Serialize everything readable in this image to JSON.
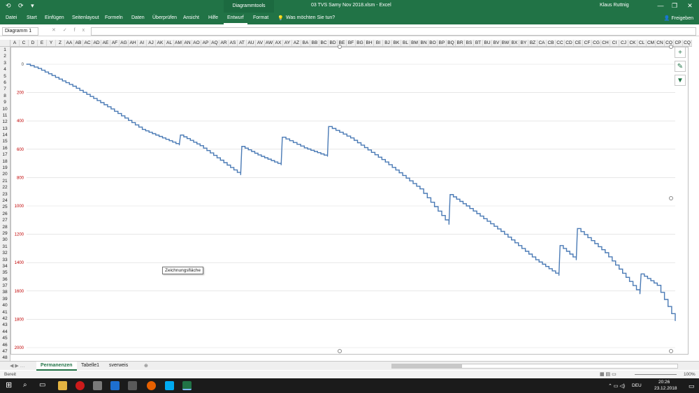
{
  "window": {
    "quick_access": "⟲ ⟳ ▾",
    "context_tab": "Diagrammtools",
    "title": "03 TVS Samy Nov 2018.xlsm  -  Excel",
    "user": "Klaus Ruttnig",
    "minimize": "—",
    "restore": "❐",
    "close": "✕"
  },
  "ribbon": {
    "tabs": [
      "Datei",
      "Start",
      "Einfügen",
      "Seitenlayout",
      "Formeln",
      "Daten",
      "Überprüfen",
      "Ansicht",
      "Hilfe",
      "Entwurf",
      "Format"
    ],
    "tell_me": "Was möchten Sie tun?",
    "share": "Freigeben"
  },
  "formula_bar": {
    "name_box": "Diagramm 1",
    "fx_label": "fx",
    "value": ""
  },
  "columns": [
    "A",
    "C",
    "D",
    "E",
    "Y",
    "Z",
    "AA",
    "AB",
    "AC",
    "AD",
    "AE",
    "AF",
    "AG",
    "AH",
    "AI",
    "AJ",
    "AK",
    "AL",
    "AM",
    "AN",
    "AO",
    "AP",
    "AQ",
    "AR",
    "AS",
    "AT",
    "AU",
    "AV",
    "AW",
    "AX",
    "AY",
    "AZ",
    "BA",
    "BB",
    "BC",
    "BD",
    "BE",
    "BF",
    "BG",
    "BH",
    "BI",
    "BJ",
    "BK",
    "BL",
    "BM",
    "BN",
    "BO",
    "BP",
    "BQ",
    "BR",
    "BS",
    "BT",
    "BU",
    "BV",
    "BW",
    "BX",
    "BY",
    "BZ",
    "CA",
    "CB",
    "CC",
    "CD",
    "CE",
    "CF",
    "CG",
    "CH",
    "CI",
    "CJ",
    "CK",
    "CL",
    "CM",
    "CN",
    "CO",
    "CP",
    "CQ"
  ],
  "rows": [
    "1",
    "2",
    "3",
    "4",
    "5",
    "6",
    "7",
    "8",
    "9",
    "10",
    "11",
    "12",
    "13",
    "14",
    "15",
    "16",
    "17",
    "18",
    "19",
    "20",
    "21",
    "22",
    "23",
    "24",
    "25",
    "26",
    "27",
    "28",
    "29",
    "30",
    "31",
    "32",
    "33",
    "34",
    "35",
    "36",
    "37",
    "38",
    "39",
    "40",
    "41",
    "42",
    "43",
    "44",
    "45",
    "46",
    "47",
    "48"
  ],
  "chart_tooltip": "Zeichnungsfläche",
  "chart_buttons": [
    "+",
    "✎",
    "▼"
  ],
  "chart_data": {
    "type": "line",
    "title": "",
    "xlabel": "",
    "ylabel": "",
    "y_axis_reversed": true,
    "ylim": [
      0,
      2000
    ],
    "yticks": [
      0,
      200,
      400,
      600,
      800,
      1000,
      1200,
      1400,
      1600,
      1800,
      2000
    ],
    "xlim": [
      0,
      56050
    ],
    "series": [
      {
        "color": "#4a7ab5",
        "x": [
          0,
          1000,
          4000,
          7000,
          10000,
          13200,
          13300,
          15000,
          18500,
          18600,
          20000,
          22000,
          22100,
          24000,
          26000,
          26100,
          28000,
          31000,
          34000,
          36500,
          36600,
          38000,
          41000,
          44000,
          46000,
          46100,
          47500,
          47600,
          50000,
          53000,
          53100,
          54500,
          56050
        ],
        "values": [
          0,
          30,
          155,
          300,
          460,
          570,
          500,
          575,
          780,
          580,
          640,
          710,
          515,
          590,
          650,
          440,
          520,
          690,
          880,
          1130,
          920,
          1000,
          1180,
          1380,
          1490,
          1280,
          1380,
          1160,
          1330,
          1620,
          1480,
          1560,
          1810
        ]
      }
    ]
  },
  "sheet_tabs": {
    "items": [
      "Permanenzen",
      "Tabelle1",
      "sverweis"
    ],
    "add": "⊕"
  },
  "status": {
    "ready": "Bereit",
    "zoom": "100%"
  },
  "taskbar": {
    "lang": "DEU",
    "time": "20:26",
    "date": "23.12.2018"
  }
}
